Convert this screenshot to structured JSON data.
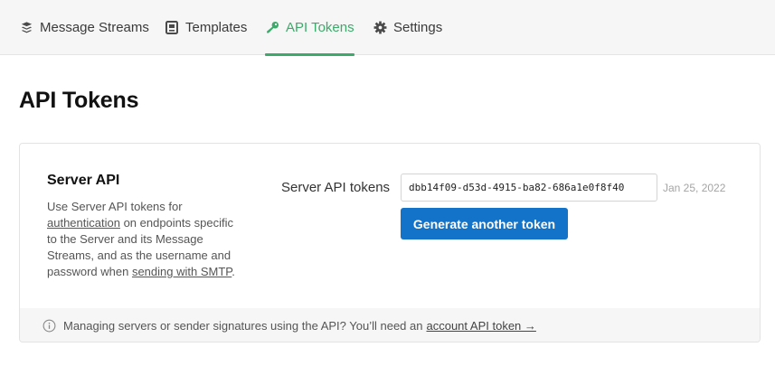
{
  "nav": {
    "tabs": [
      {
        "label": "Message Streams",
        "icon": "stack-icon"
      },
      {
        "label": "Templates",
        "icon": "template-icon"
      },
      {
        "label": "API Tokens",
        "icon": "key-icon",
        "active": true
      },
      {
        "label": "Settings",
        "icon": "gear-icon"
      }
    ]
  },
  "page": {
    "title": "API Tokens"
  },
  "server_api": {
    "title": "Server API",
    "desc_1": "Use Server API tokens for",
    "desc_link_1": "authentication",
    "desc_2": " on endpoints specific to the Server and its Message Streams, and as the username and password when ",
    "desc_link_2": "sending with SMTP",
    "desc_3": "."
  },
  "tokens": {
    "label": "Server API tokens",
    "value": "dbb14f09-d53d-4915-ba82-686a1e0f8f40",
    "date": "Jan 25, 2022",
    "generate_label": "Generate another token"
  },
  "footer": {
    "text": "Managing servers or sender signatures using the API? You’ll need an",
    "link": "account API token →"
  },
  "colors": {
    "accent": "#3daa6b",
    "button": "#1373c8"
  }
}
